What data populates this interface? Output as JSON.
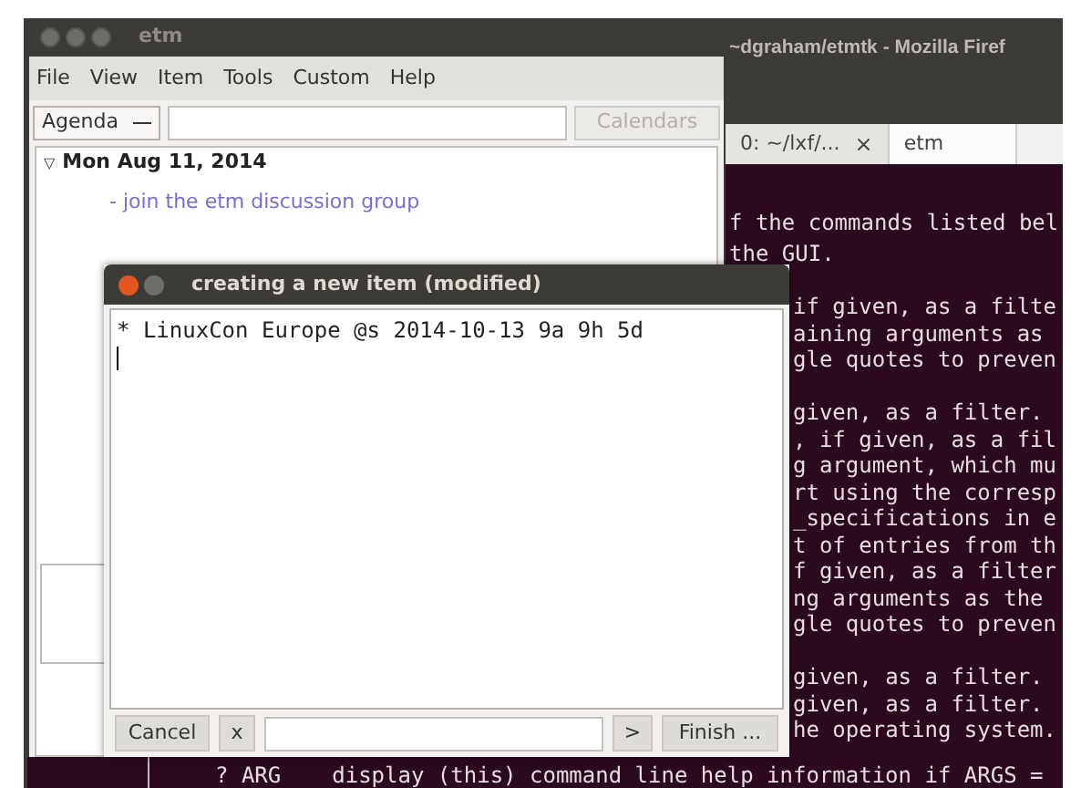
{
  "browser_window": {
    "title": "~dgraham/etmtk - Mozilla Firef"
  },
  "terminal": {
    "tabs": [
      {
        "label": "0: ~/lxf/...",
        "selected": false,
        "close": "×"
      },
      {
        "label": "etm",
        "selected": true
      }
    ],
    "upper_lines": [
      "f the commands listed bel",
      "the GUI."
    ],
    "side_paragraphs": [
      [
        "if given, as a filte",
        "aining arguments as",
        "gle quotes to preven"
      ],
      [
        "given, as a filter.",
        ", if given, as a fil",
        "g argument, which mu",
        "rt using the corresp",
        "_specifications in e",
        "t of entries from th",
        "f given, as a filter",
        "ng arguments as the",
        "gle quotes to preven"
      ],
      [
        "given, as a filter.",
        "given, as a filter.",
        "he operating system."
      ]
    ],
    "bottom_line": {
      "command": "? ARG",
      "description": "display (this) command line help information if ARGS ="
    }
  },
  "main_window": {
    "title": "etm",
    "menu": [
      "File",
      "View",
      "Item",
      "Tools",
      "Custom",
      "Help"
    ],
    "view_selector": "Agenda",
    "calendars_button": {
      "label": "Calendars",
      "disabled": true
    },
    "tree": [
      {
        "label": "Mon Aug 11, 2014",
        "expander": "▽",
        "expanded": true,
        "children": [
          {
            "label": "- join the etm discussion group"
          }
        ]
      }
    ]
  },
  "dialog": {
    "title": "creating a new item (modified)",
    "text": "* LinuxCon Europe @s 2014-10-13 9a 9h 5d",
    "cancel": "Cancel",
    "clear": "x",
    "next": ">",
    "finish": "Finish ..."
  }
}
